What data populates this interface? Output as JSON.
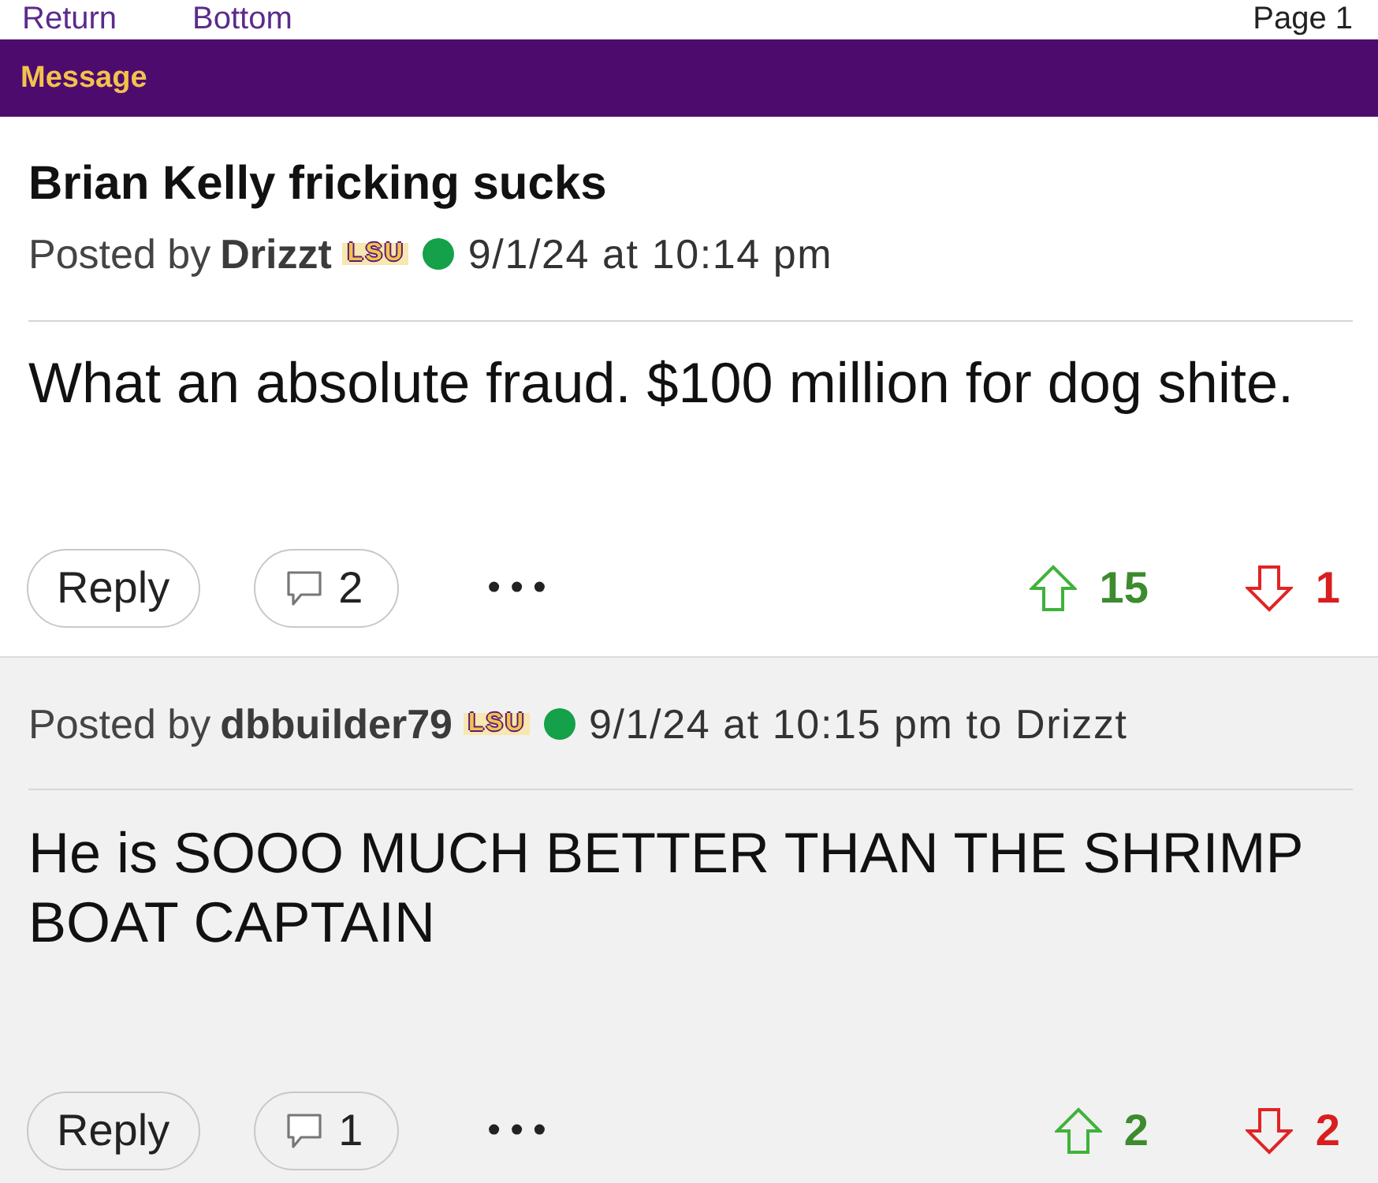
{
  "nav": {
    "links": [
      "Return",
      "Bottom"
    ],
    "page_indicator": "Page 1"
  },
  "header": {
    "title": "Message"
  },
  "posts": [
    {
      "kind": "original",
      "title": "Brian Kelly fricking sucks",
      "byline_prefix": "Posted by",
      "author": "Drizzt",
      "badge": "LSU",
      "online": true,
      "date": "9/1/24 at 10:14 pm",
      "body": "What an absolute fraud. $100 million for dog shite.",
      "reply_label": "Reply",
      "comment_count": "2",
      "more": "•••",
      "upvotes": "15",
      "downvotes": "1"
    },
    {
      "kind": "reply",
      "byline_prefix": "Posted by",
      "author": "dbbuilder79",
      "badge": "LSU",
      "online": true,
      "date": "9/1/24 at 10:15 pm to Drizzt",
      "body": "He is SOOO MUCH BETTER THAN THE SHRIMP BOAT CAPTAIN",
      "reply_label": "Reply",
      "comment_count": "1",
      "more": "•••",
      "upvotes": "2",
      "downvotes": "2"
    }
  ]
}
